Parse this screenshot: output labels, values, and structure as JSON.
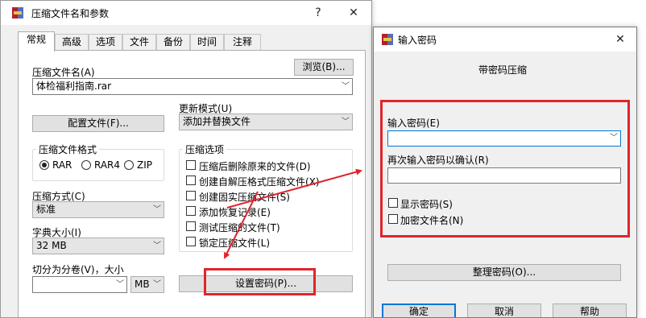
{
  "main_window": {
    "title": "压缩文件名和参数",
    "title_buttons": {
      "help": "?",
      "close": "✕"
    },
    "tabs": [
      "常规",
      "高级",
      "选项",
      "文件",
      "备份",
      "时间",
      "注释"
    ],
    "archive_name_label": "压缩文件名(A)",
    "browse_button": "浏览(B)...",
    "archive_name_value": "体检福利指南.rar",
    "profiles_button": "配置文件(F)...",
    "update_mode_label": "更新模式(U)",
    "update_mode_value": "添加并替换文件",
    "format_group_title": "压缩文件格式",
    "formats": [
      "RAR",
      "RAR4",
      "ZIP"
    ],
    "compression_options_title": "压缩选项",
    "options": [
      "压缩后删除原来的文件(D)",
      "创建自解压格式压缩文件(X)",
      "创建固实压缩文件(S)",
      "添加恢复记录(E)",
      "测试压缩的文件(T)",
      "锁定压缩文件(L)"
    ],
    "method_label": "压缩方式(C)",
    "method_value": "标准",
    "dict_label": "字典大小(I)",
    "dict_value": "32 MB",
    "split_label": "切分为分卷(V)，大小",
    "split_value": "",
    "split_unit": "MB",
    "set_password_button": "设置密码(P)..."
  },
  "password_dialog": {
    "title": "输入密码",
    "close": "✕",
    "subtitle": "带密码压缩",
    "enter_password_label": "输入密码(E)",
    "enter_password_value": "",
    "reenter_label": "再次输入密码以确认(R)",
    "reenter_value": "",
    "show_password_label": "显示密码(S)",
    "encrypt_names_label": "加密文件名(N)",
    "organize_button": "整理密码(O)...",
    "ok_button": "确定",
    "cancel_button": "取消",
    "help_button": "帮助"
  },
  "colors": {
    "highlight_red": "#e0242b",
    "dialog_bg": "#f0f0f0",
    "focus_blue": "#0078d7"
  },
  "icons": {
    "app_icon": "winrar-books-icon",
    "dropdown": "chevron-down-icon"
  }
}
